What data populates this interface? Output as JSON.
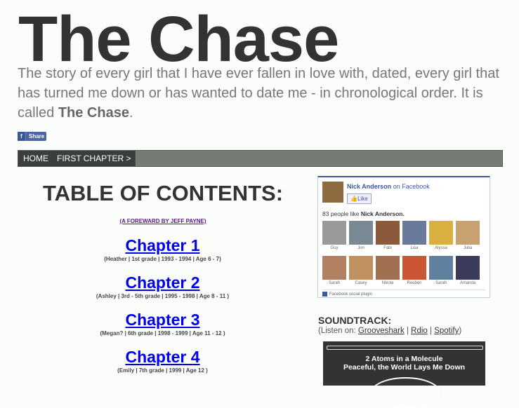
{
  "site": {
    "title": "The Chase",
    "tagline_pre": "The story of every girl that I have ever fallen in love with, dated, every girl that has turned me down or has wanted to date me - in chronological order. It is called ",
    "tagline_bold": "The Chase",
    "tagline_post": "."
  },
  "share": {
    "label": "Share",
    "icon": "facebook-f-icon"
  },
  "nav": {
    "items": [
      "HOME",
      "FIRST CHAPTER >"
    ]
  },
  "toc": {
    "title": "TABLE OF CONTENTS:",
    "foreword": "(A FOREWARD BY JEFF PAYNE)",
    "chapters": [
      {
        "label": "Chapter 1",
        "sub": "(Heather | 1st grade | 1993 - 1994 | Age 6 - 7)"
      },
      {
        "label": "Chapter 2",
        "sub": "(Ashley | 3rd - 5th grade | 1995 - 1998 | Age 8 - 11 )"
      },
      {
        "label": "Chapter 3",
        "sub": "(Megan? | 6th grade | 1998 - 1999 | Age 11 - 12 )"
      },
      {
        "label": "Chapter 4",
        "sub": "(Emily | 7th grade | 1999 | Age 12 )"
      }
    ]
  },
  "facebook": {
    "name": "Nick Anderson",
    "on": " on Facebook",
    "like": "Like",
    "count_pre": "83 people like ",
    "count_name": "Nick Anderson.",
    "faces": [
      "Guy",
      "Jon",
      "Fabi",
      "Lisa",
      "Alyssa",
      "Julia",
      "Sarah",
      "Casey",
      "Nikola",
      "Reuben",
      "Sarah",
      "Amanda"
    ],
    "face_colors": [
      "#9a9a9a",
      "#7a8a95",
      "#8a5a3a",
      "#6a7a9a",
      "#d9b040",
      "#c9a070",
      "#b08060",
      "#c09060",
      "#a07050",
      "#cc5533",
      "#6080a0",
      "#3a3a5a"
    ],
    "plugin": "Facebook social plugin"
  },
  "soundtrack": {
    "title": "SOUNDTRACK:",
    "listen_pre": "(Listen on: ",
    "services": [
      "Grooveshark",
      "Rdio",
      "Spotify"
    ],
    "sep": " | ",
    "listen_post": ")",
    "track_line1": "2 Atoms in a Molecule",
    "track_line2": "Peaceful, the World Lays Me Down"
  }
}
